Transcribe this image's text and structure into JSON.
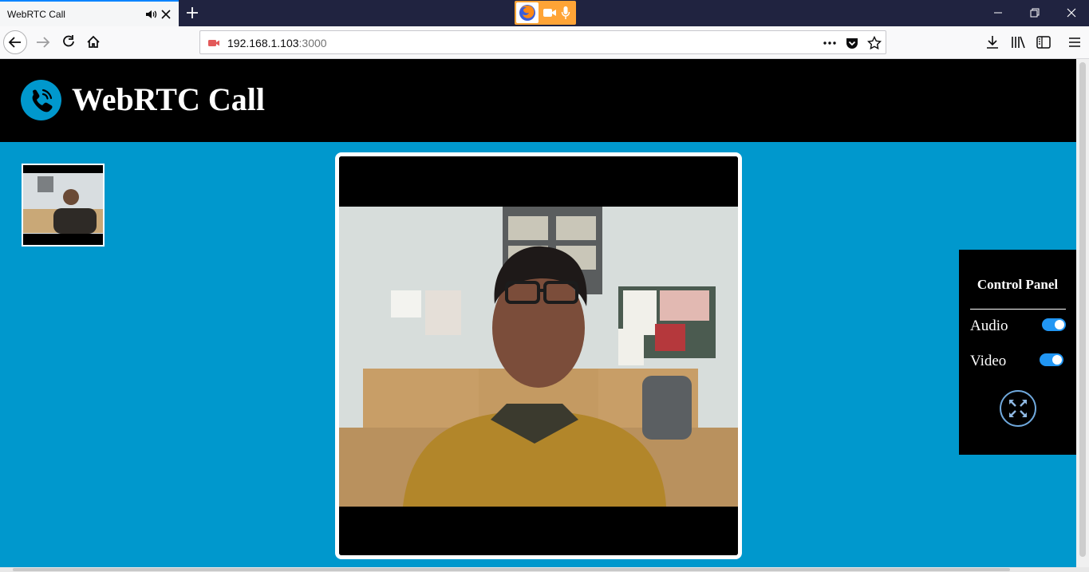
{
  "browser": {
    "tab_title": "WebRTC Call",
    "url_host": "192.168.1.103",
    "url_port": ":3000"
  },
  "app": {
    "title": "WebRTC Call"
  },
  "control_panel": {
    "title": "Control Panel",
    "audio_label": "Audio",
    "video_label": "Video",
    "audio_enabled": true,
    "video_enabled": true
  },
  "colors": {
    "page_background": "#0098cd",
    "header_background": "#000000",
    "toggle_on": "#2196f3",
    "sharing_indicator": "#ffa436"
  },
  "icons": [
    "phone-icon",
    "fullscreen-icon",
    "speaker-icon",
    "close-icon",
    "plus-icon",
    "firefox-icon",
    "camera-icon",
    "microphone-icon",
    "back-icon",
    "forward-icon",
    "reload-icon",
    "home-icon",
    "camera-blocked-icon",
    "more-icon",
    "pocket-icon",
    "star-icon",
    "download-icon",
    "library-icon",
    "sidebar-icon",
    "menu-icon",
    "minimize-icon",
    "restore-icon"
  ]
}
